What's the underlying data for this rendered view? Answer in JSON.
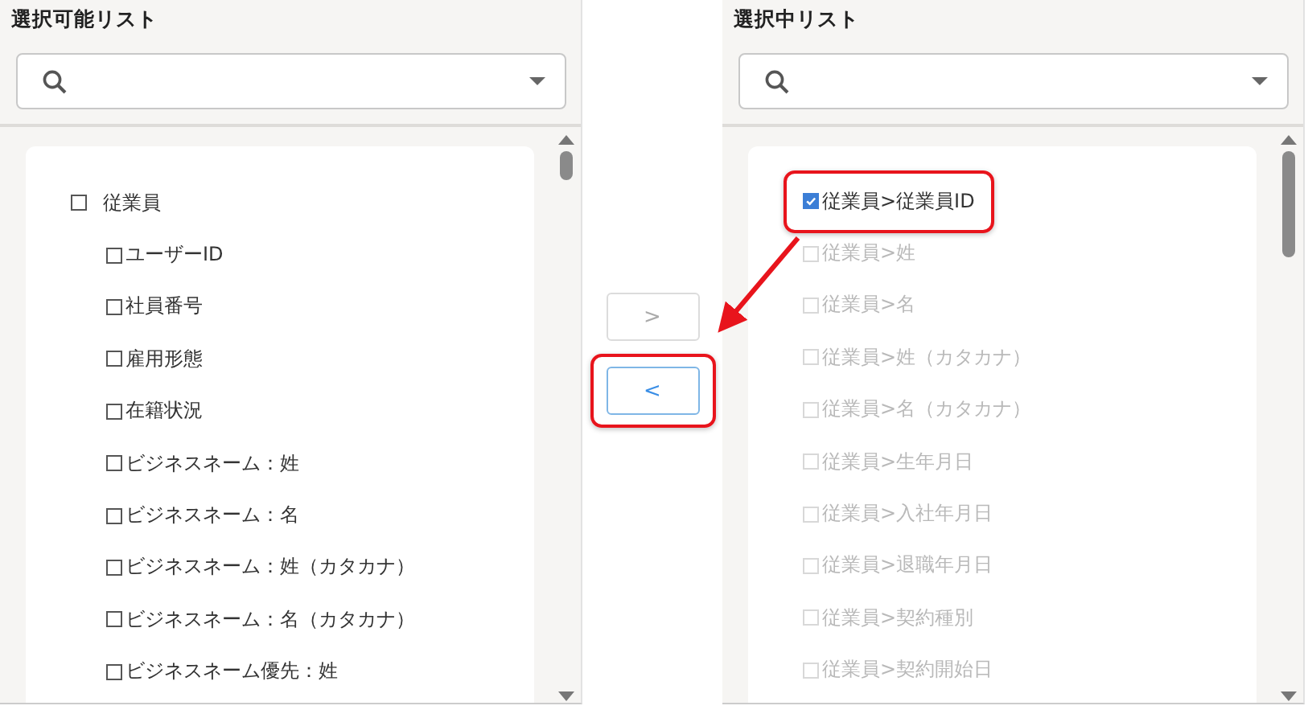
{
  "panels": [
    {
      "title": "選択可能リスト",
      "items": [
        {
          "label": "従業員",
          "checked": false,
          "disabled": false,
          "highlighted": false,
          "children": [
            {
              "label": "ユーザーID",
              "checked": false,
              "disabled": false,
              "highlighted": false
            },
            {
              "label": "社員番号",
              "checked": false,
              "disabled": false,
              "highlighted": false
            },
            {
              "label": "雇用形態",
              "checked": false,
              "disabled": false,
              "highlighted": false
            },
            {
              "label": "在籍状況",
              "checked": false,
              "disabled": false,
              "highlighted": false
            },
            {
              "label": "ビジネスネーム：姓",
              "checked": false,
              "disabled": false,
              "highlighted": false
            },
            {
              "label": "ビジネスネーム：名",
              "checked": false,
              "disabled": false,
              "highlighted": false
            },
            {
              "label": "ビジネスネーム：姓（カタカナ）",
              "checked": false,
              "disabled": false,
              "highlighted": false
            },
            {
              "label": "ビジネスネーム：名（カタカナ）",
              "checked": false,
              "disabled": false,
              "highlighted": false
            },
            {
              "label": "ビジネスネーム優先：姓",
              "checked": false,
              "disabled": false,
              "highlighted": false
            }
          ]
        }
      ]
    },
    {
      "title": "選択中リスト",
      "items": [
        {
          "label": "従業員>従業員ID",
          "checked": true,
          "disabled": false,
          "highlighted": true
        },
        {
          "label": "従業員>姓",
          "checked": false,
          "disabled": true,
          "highlighted": false
        },
        {
          "label": "従業員>名",
          "checked": false,
          "disabled": true,
          "highlighted": false
        },
        {
          "label": "従業員>姓（カタカナ）",
          "checked": false,
          "disabled": true,
          "highlighted": false
        },
        {
          "label": "従業員>名（カタカナ）",
          "checked": false,
          "disabled": true,
          "highlighted": false
        },
        {
          "label": "従業員>生年月日",
          "checked": false,
          "disabled": true,
          "highlighted": false
        },
        {
          "label": "従業員>入社年月日",
          "checked": false,
          "disabled": true,
          "highlighted": false
        },
        {
          "label": "従業員>退職年月日",
          "checked": false,
          "disabled": true,
          "highlighted": false
        },
        {
          "label": "従業員>契約種別",
          "checked": false,
          "disabled": true,
          "highlighted": false
        },
        {
          "label": "従業員>契約開始日",
          "checked": false,
          "disabled": true,
          "highlighted": false
        }
      ]
    }
  ],
  "transfer_buttons": [
    {
      "label": ">",
      "disabled": true,
      "highlighted": false
    },
    {
      "label": "<",
      "disabled": false,
      "highlighted": true
    }
  ]
}
